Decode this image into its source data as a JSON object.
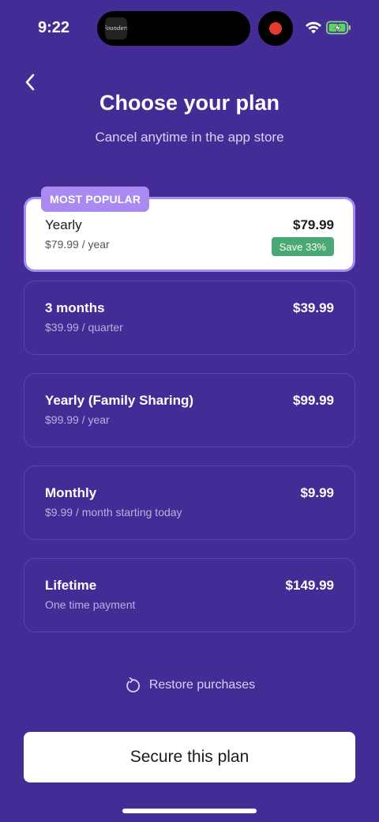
{
  "status_bar": {
    "time": "9:22",
    "island_thumb_text": "Founders",
    "wifi_icon": "wifi-icon",
    "battery_icon": "battery-charging-icon"
  },
  "header": {
    "back_icon": "chevron-left-icon",
    "title": "Choose your plan",
    "subtitle": "Cancel anytime in the app store"
  },
  "plans": [
    {
      "name": "Yearly",
      "detail": "$79.99 / year",
      "price": "$79.99",
      "badge": "MOST POPULAR",
      "save": "Save 33%",
      "selected": true
    },
    {
      "name": "3 months",
      "detail": "$39.99 / quarter",
      "price": "$39.99"
    },
    {
      "name": "Yearly (Family Sharing)",
      "detail": "$99.99 / year",
      "price": "$99.99"
    },
    {
      "name": "Monthly",
      "detail": "$9.99 / month starting today",
      "price": "$9.99"
    },
    {
      "name": "Lifetime",
      "detail": "One time payment",
      "price": "$149.99"
    }
  ],
  "restore": {
    "label": "Restore purchases",
    "icon": "restore-icon"
  },
  "cta": {
    "label": "Secure this plan"
  },
  "colors": {
    "background": "#432c96",
    "accent": "#a88af0",
    "save_badge": "#4aa874",
    "record_dot": "#e53a2f"
  }
}
